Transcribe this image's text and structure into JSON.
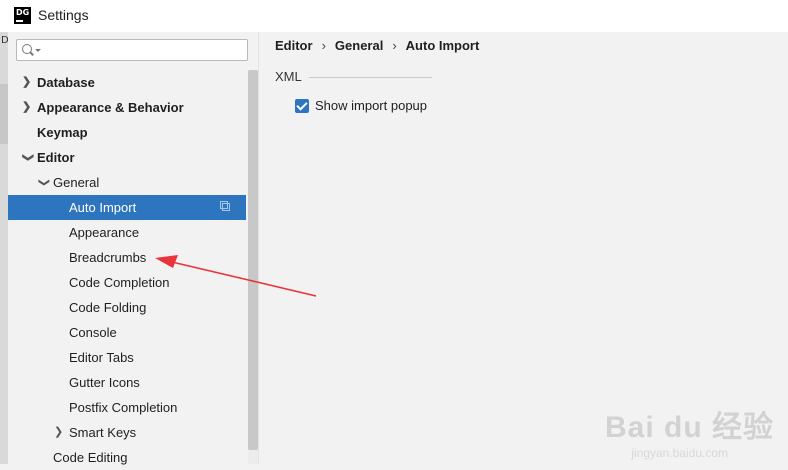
{
  "window": {
    "title": "Settings",
    "logo_text": "DG"
  },
  "left_strip": {
    "letter": "D"
  },
  "search": {
    "placeholder": "",
    "value": ""
  },
  "tree": {
    "items": [
      {
        "label": "Database",
        "chevron": "right",
        "bold": true
      },
      {
        "label": "Appearance & Behavior",
        "chevron": "right",
        "bold": true
      },
      {
        "label": "Keymap",
        "chevron": "",
        "bold": true
      },
      {
        "label": "Editor",
        "chevron": "down",
        "bold": true
      },
      {
        "label": "General",
        "chevron": "down",
        "bold": false
      },
      {
        "label": "Auto Import",
        "chevron": "",
        "bold": false,
        "selected": true
      },
      {
        "label": "Appearance",
        "chevron": "",
        "bold": false
      },
      {
        "label": "Breadcrumbs",
        "chevron": "",
        "bold": false
      },
      {
        "label": "Code Completion",
        "chevron": "",
        "bold": false
      },
      {
        "label": "Code Folding",
        "chevron": "",
        "bold": false
      },
      {
        "label": "Console",
        "chevron": "",
        "bold": false
      },
      {
        "label": "Editor Tabs",
        "chevron": "",
        "bold": false
      },
      {
        "label": "Gutter Icons",
        "chevron": "",
        "bold": false
      },
      {
        "label": "Postfix Completion",
        "chevron": "",
        "bold": false
      },
      {
        "label": "Smart Keys",
        "chevron": "right",
        "bold": false
      },
      {
        "label": "Code Editing",
        "chevron": "",
        "bold": false
      }
    ]
  },
  "breadcrumb": {
    "part1": "Editor",
    "part2": "General",
    "part3": "Auto Import",
    "separator": "›"
  },
  "content": {
    "section_title": "XML",
    "checkbox_label": "Show import popup",
    "checkbox_checked": true
  },
  "watermark": {
    "brand": "Bai du 经验",
    "url": "jingyan.baidu.com"
  },
  "colors": {
    "selection": "#2e75c0",
    "annotation_arrow": "#e8343a",
    "background": "#f2f2f2"
  }
}
